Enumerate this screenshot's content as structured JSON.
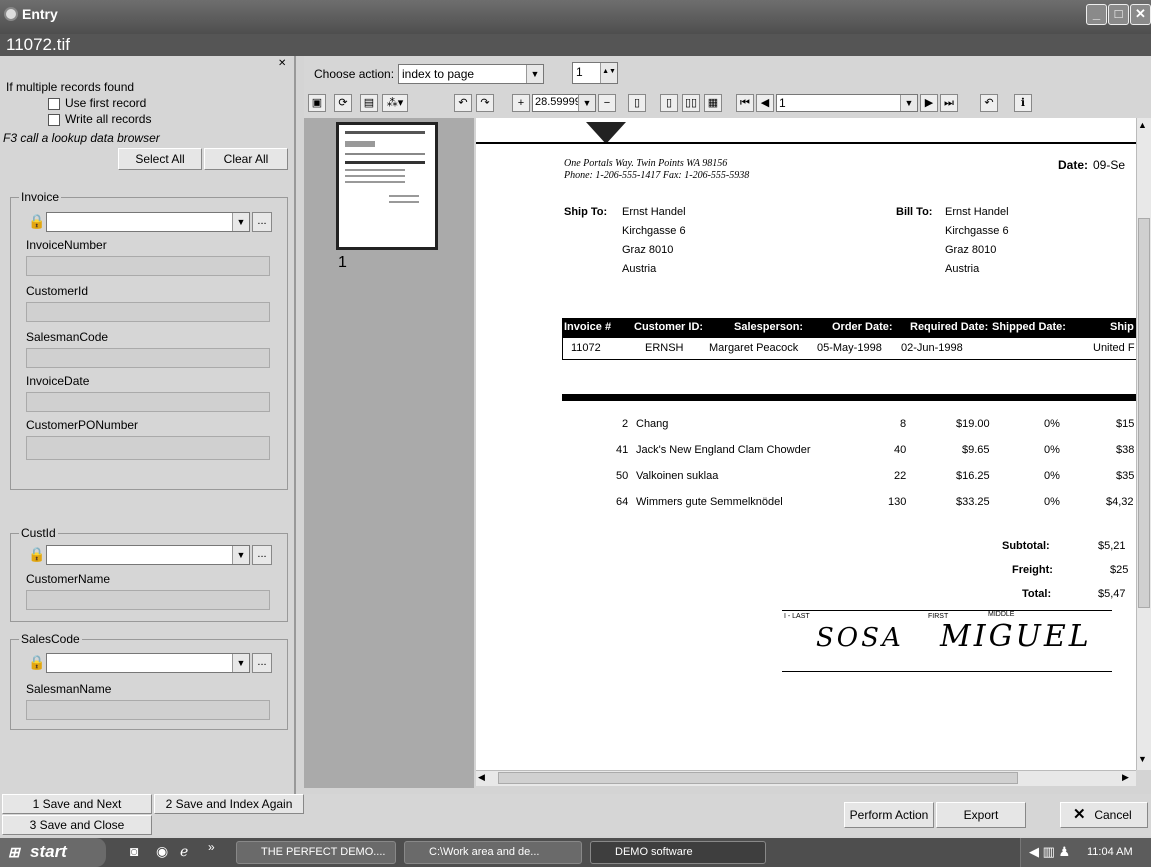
{
  "window": {
    "title": "Entry",
    "filename": "11072.tif"
  },
  "left": {
    "options_label": "If multiple records found",
    "use_first": "Use first record",
    "write_all": "Write all records",
    "f3_hint": "F3 call a lookup data browser",
    "select_all": "Select All",
    "clear_all": "Clear All",
    "invoice_group": "Invoice",
    "invoice_number_label": "InvoiceNumber",
    "customer_id_label": "CustomerId",
    "salesman_code_label": "SalesmanCode",
    "invoice_date_label": "InvoiceDate",
    "po_number_label": "CustomerPONumber",
    "custid_group": "CustId",
    "customer_name_label": "CustomerName",
    "salescode_group": "SalesCode",
    "salesman_name_label": "SalesmanName",
    "dots": "..."
  },
  "toolbar": {
    "choose_action_label": "Choose action:",
    "action_value": "index to page",
    "page_spin": "1",
    "zoom_value": "28.59999",
    "page_select": "1"
  },
  "thumb": {
    "page_label": "1"
  },
  "doc": {
    "address": "One Portals Way. Twin Points WA  98156",
    "phone": "Phone: 1-206-555-1417   Fax: 1-206-555-5938",
    "date_label": "Date:",
    "date_value": "09-Se",
    "ship_to_label": "Ship To:",
    "bill_to_label": "Bill To:",
    "ship_name": "Ernst Handel",
    "ship_street": "Kirchgasse 6",
    "ship_city": "Graz  8010",
    "ship_country": "Austria",
    "bill_name": "Ernst Handel",
    "bill_street": "Kirchgasse 6",
    "bill_city": "Graz  8010",
    "bill_country": "Austria",
    "headers": [
      "Invoice #",
      "Customer ID:",
      "Salesperson:",
      "Order Date:",
      "Required Date:",
      "Shipped Date:",
      "Ship"
    ],
    "row": [
      "11072",
      "ERNSH",
      "Margaret Peacock",
      "05-May-1998",
      "02-Jun-1998",
      "",
      "United F"
    ],
    "items": [
      {
        "id": "2",
        "name": "Chang",
        "qty": "8",
        "price": "$19.00",
        "disc": "0%",
        "total": "$15"
      },
      {
        "id": "41",
        "name": "Jack's New England Clam Chowder",
        "qty": "40",
        "price": "$9.65",
        "disc": "0%",
        "total": "$38"
      },
      {
        "id": "50",
        "name": "Valkoinen suklaa",
        "qty": "22",
        "price": "$16.25",
        "disc": "0%",
        "total": "$35"
      },
      {
        "id": "64",
        "name": "Wimmers gute Semmelknödel",
        "qty": "130",
        "price": "$33.25",
        "disc": "0%",
        "total": "$4,32"
      }
    ],
    "subtotal_label": "Subtotal:",
    "subtotal": "$5,21",
    "freight_label": "Freight:",
    "freight": "$25",
    "total_label": "Total:",
    "total": "$5,47",
    "sig_last": "I - LAST",
    "sig_first": "FIRST",
    "sig_middle": "MIDDLE",
    "sig_text1": "SOSA",
    "sig_text2": "MIGUEL"
  },
  "bottom": {
    "save_next": "1 Save and Next",
    "save_index": "2 Save and Index Again",
    "save_close": "3 Save and Close",
    "perform_action": "Perform Action",
    "export": "Export",
    "cancel": "Cancel"
  },
  "taskbar": {
    "start": "start",
    "task1": "THE PERFECT DEMO....",
    "task2": "C:\\Work area and de...",
    "task3": "DEMO software",
    "clock": "11:04 AM"
  }
}
